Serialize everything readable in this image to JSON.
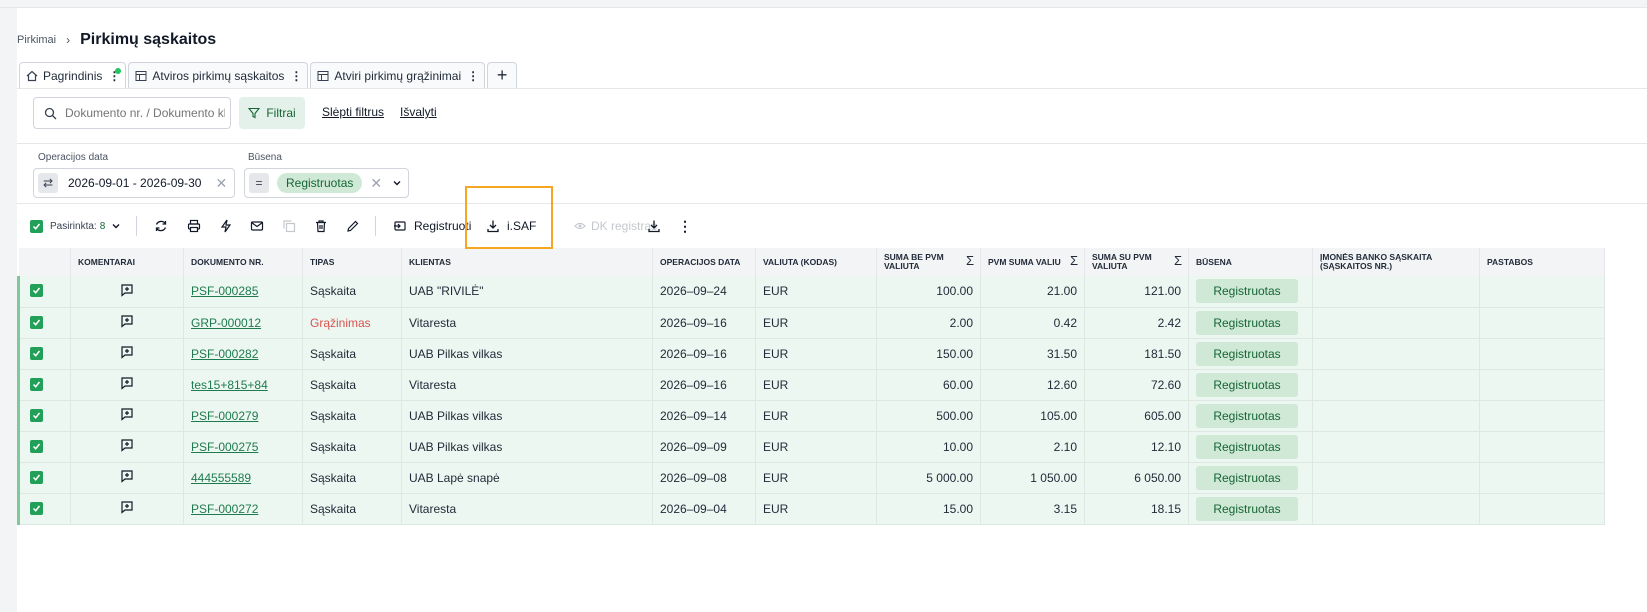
{
  "breadcrumb": {
    "parent": "Pirkimai",
    "title": "Pirkimų sąskaitos"
  },
  "tabs": [
    {
      "label": "Pagrindinis"
    },
    {
      "label": "Atviros pirkimų sąskaitos"
    },
    {
      "label": "Atviri pirkimų grąžinimai"
    }
  ],
  "search": {
    "placeholder": "Dokumento nr. / Dokumento kl"
  },
  "filterbar": {
    "filters_label": "Filtrai",
    "hide_filters": "Slėpti filtrus",
    "clear": "Išvalyti"
  },
  "filters": {
    "date": {
      "label": "Operacijos data",
      "value": "2026-09-01 - 2026-09-30"
    },
    "status": {
      "label": "Būsena",
      "op": "=",
      "value": "Registruotas"
    }
  },
  "toolbar": {
    "selected_label": "Pasirinkta:",
    "selected_count": "8",
    "register": "Registruoti",
    "isaf": "i.SAF",
    "dk_register": "DK registras"
  },
  "columns": {
    "comments": "Komentarai",
    "doc_no": "Dokumento nr.",
    "type": "Tipas",
    "client": "Klientas",
    "op_date": "Operacijos data",
    "currency": "Valiuta (kodas)",
    "sum_no_vat": "Suma be PVM valiuta",
    "vat_sum": "PVM suma valiu",
    "sum_with_vat": "Suma su PVM valiuta",
    "status": "Būsena",
    "bank_account": "Įmonės banko sąskaita (sąskaitos nr.)",
    "notes": "Pastabos"
  },
  "rows": [
    {
      "doc": "PSF-000285",
      "type": "Sąskaita",
      "client": "UAB \"RIVILĖ\"",
      "date": "2026–09–24",
      "cur": "EUR",
      "net": "100.00",
      "vat": "21.00",
      "gross": "121.00",
      "status": "Registruotas"
    },
    {
      "doc": "GRP-000012",
      "type": "Grąžinimas",
      "client": "Vitaresta",
      "date": "2026–09–16",
      "cur": "EUR",
      "net": "2.00",
      "vat": "0.42",
      "gross": "2.42",
      "status": "Registruotas"
    },
    {
      "doc": "PSF-000282",
      "type": "Sąskaita",
      "client": "UAB Pilkas vilkas",
      "date": "2026–09–16",
      "cur": "EUR",
      "net": "150.00",
      "vat": "31.50",
      "gross": "181.50",
      "status": "Registruotas"
    },
    {
      "doc": "tes15+815+84",
      "type": "Sąskaita",
      "client": "Vitaresta",
      "date": "2026–09–16",
      "cur": "EUR",
      "net": "60.00",
      "vat": "12.60",
      "gross": "72.60",
      "status": "Registruotas"
    },
    {
      "doc": "PSF-000279",
      "type": "Sąskaita",
      "client": "UAB Pilkas vilkas",
      "date": "2026–09–14",
      "cur": "EUR",
      "net": "500.00",
      "vat": "105.00",
      "gross": "605.00",
      "status": "Registruotas"
    },
    {
      "doc": "PSF-000275",
      "type": "Sąskaita",
      "client": "UAB Pilkas vilkas",
      "date": "2026–09–09",
      "cur": "EUR",
      "net": "10.00",
      "vat": "2.10",
      "gross": "12.10",
      "status": "Registruotas"
    },
    {
      "doc": "444555589",
      "type": "Sąskaita",
      "client": "UAB Lapė snapė",
      "date": "2026–09–08",
      "cur": "EUR",
      "net": "5 000.00",
      "vat": "1 050.00",
      "gross": "6 050.00",
      "status": "Registruotas"
    },
    {
      "doc": "PSF-000272",
      "type": "Sąskaita",
      "client": "Vitaresta",
      "date": "2026–09–04",
      "cur": "EUR",
      "net": "15.00",
      "vat": "3.15",
      "gross": "18.15",
      "status": "Registruotas"
    }
  ],
  "colors": {
    "accent": "#22a05a",
    "row_bg": "#ecf7f1",
    "highlight": "#f5a623",
    "return_type": "#d9534f"
  }
}
